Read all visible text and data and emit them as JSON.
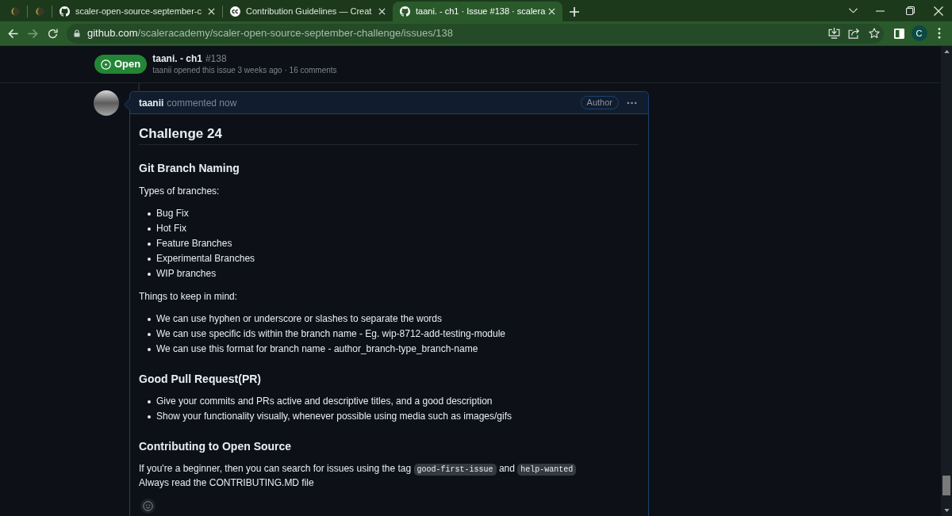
{
  "browser": {
    "tabs": [
      {
        "kind": "pinned",
        "selected": false
      },
      {
        "kind": "pinned",
        "selected": false
      },
      {
        "kind": "page",
        "title": "scaler-open-source-september-c",
        "selected": false
      },
      {
        "kind": "page",
        "title": "Contribution Guidelines — Creat",
        "selected": false
      },
      {
        "kind": "page",
        "title": "taani. - ch1 · Issue #138 · scalera",
        "selected": true
      }
    ],
    "nav_buttons": [
      {
        "kind": "back",
        "disabled": false
      },
      {
        "kind": "forward",
        "disabled": true
      },
      {
        "kind": "reload",
        "disabled": false
      }
    ],
    "address": {
      "host": "github.com",
      "path": "/scaleracademy/scaler-open-source-september-challenge/issues/138"
    },
    "profile_initial": "C"
  },
  "issue_header": {
    "state": {
      "kind": "open",
      "label": "Open"
    },
    "title": "taani. - ch1",
    "number": "#138",
    "meta": "taanii opened this issue 3 weeks ago · 16 comments"
  },
  "comment": {
    "author": "taanii",
    "action": "commented now",
    "role": "Author",
    "body": [
      {
        "kind": "h1",
        "text": "Challenge 24"
      },
      {
        "kind": "h2",
        "text": "Git Branch Naming"
      },
      {
        "kind": "p",
        "lines": [
          [
            {
              "kind": "text",
              "text": "Types of branches:"
            }
          ]
        ]
      },
      {
        "kind": "ul",
        "items": [
          "Bug Fix",
          "Hot Fix",
          "Feature Branches",
          "Experimental Branches",
          "WIP branches"
        ]
      },
      {
        "kind": "p",
        "lines": [
          [
            {
              "kind": "text",
              "text": "Things to keep in mind:"
            }
          ]
        ]
      },
      {
        "kind": "ul",
        "items": [
          "We can use hyphen or underscore or slashes to separate the words",
          "We can use specific ids within the branch name - Eg. wip-8712-add-testing-module",
          "We can use this format for branch name - author_branch-type_branch-name"
        ]
      },
      {
        "kind": "h2",
        "text": "Good Pull Request(PR)"
      },
      {
        "kind": "ul",
        "items": [
          "Give your commits and PRs active and descriptive titles, and a good description",
          "Show your functionality visually, whenever possible using media such as images/gifs"
        ]
      },
      {
        "kind": "h2",
        "text": "Contributing to Open Source"
      },
      {
        "kind": "p",
        "lines": [
          [
            {
              "kind": "text",
              "text": "If you're a beginner, then you can search for issues using the tag"
            },
            {
              "kind": "code",
              "text": "good-first-issue"
            },
            {
              "kind": "text",
              "text": "and"
            },
            {
              "kind": "code",
              "text": "help-wanted"
            }
          ],
          [
            {
              "kind": "text",
              "text": "Always read the CONTRIBUTING.MD file"
            }
          ]
        ]
      }
    ]
  }
}
